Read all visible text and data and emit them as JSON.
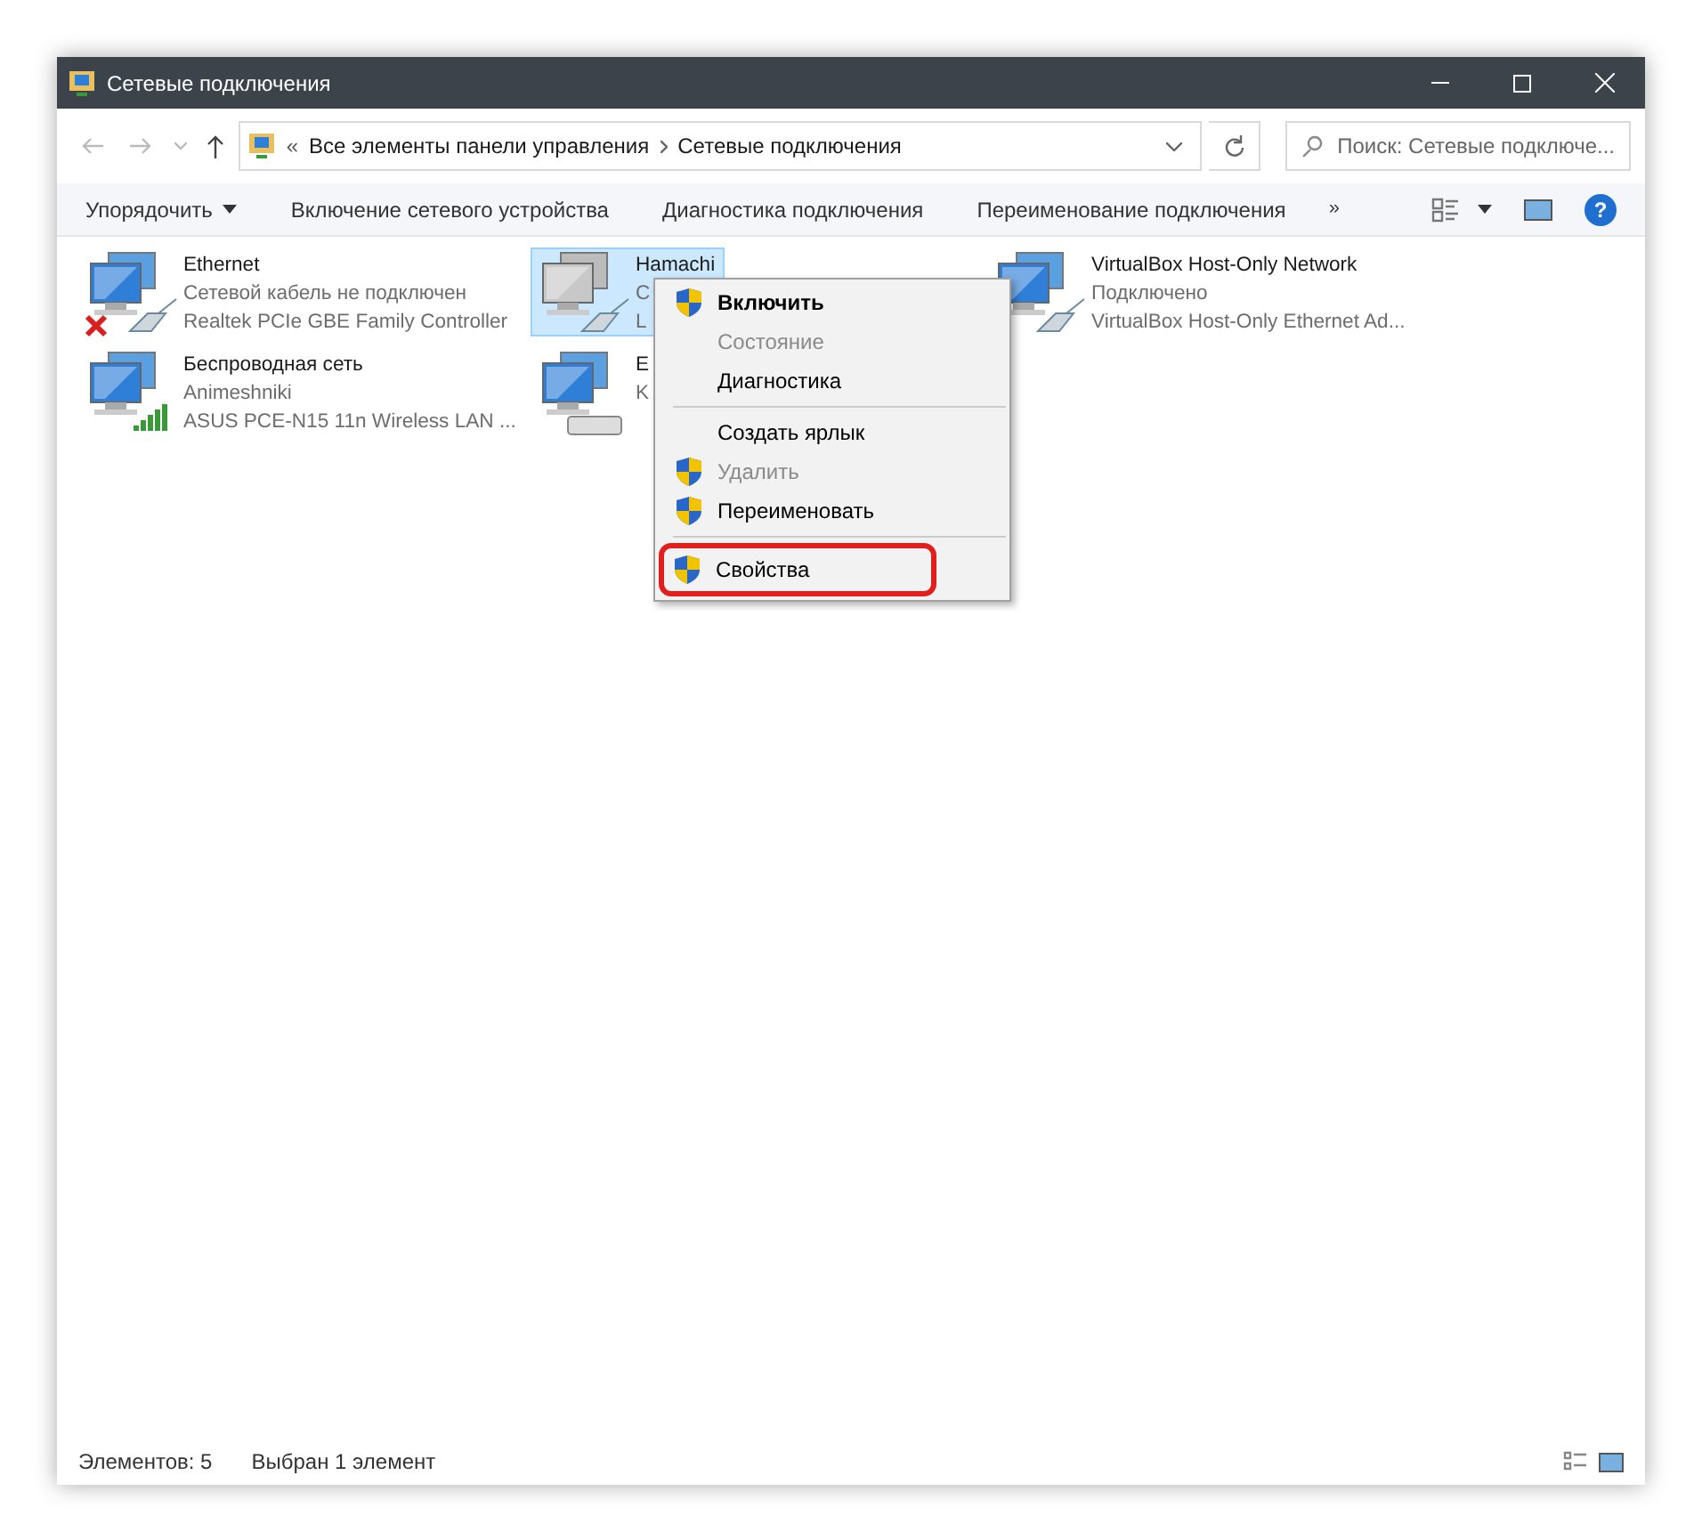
{
  "window": {
    "title": "Сетевые подключения"
  },
  "address": {
    "overflow": "«",
    "crumbs": [
      "Все элементы панели управления",
      "Сетевые подключения"
    ]
  },
  "search": {
    "placeholder": "Поиск: Сетевые подключе..."
  },
  "toolbar": {
    "items": [
      "Упорядочить",
      "Включение сетевого устройства",
      "Диагностика подключения",
      "Переименование подключения"
    ],
    "more": "»",
    "help": "?"
  },
  "connections": [
    {
      "name": "Ethernet",
      "status": "Сетевой кабель не подключен",
      "device": "Realtek PCIe GBE Family Controller",
      "kind": "cable",
      "disconnected": true,
      "selected": false
    },
    {
      "name": "Hamachi",
      "status": "С",
      "device": "L",
      "kind": "cable-grey",
      "disconnected": false,
      "selected": true
    },
    {
      "name": "VirtualBox Host-Only Network",
      "status": "Подключено",
      "device": "VirtualBox Host-Only Ethernet Ad...",
      "kind": "cable",
      "disconnected": false,
      "selected": false
    },
    {
      "name": "Беспроводная сеть",
      "status": "Animeshniki",
      "device": "ASUS PCE-N15 11n Wireless LAN ...",
      "kind": "wireless",
      "disconnected": false,
      "selected": false
    },
    {
      "name": "E",
      "status": "K",
      "kind": "dialup",
      "disconnected": false,
      "selected": false
    }
  ],
  "context_menu": [
    {
      "kind": "item",
      "label": "Включить",
      "bold": true,
      "disabled": false,
      "shield": true,
      "highlighted": false
    },
    {
      "kind": "item",
      "label": "Состояние",
      "bold": false,
      "disabled": true,
      "shield": false,
      "highlighted": false
    },
    {
      "kind": "item",
      "label": "Диагностика",
      "bold": false,
      "disabled": false,
      "shield": false,
      "highlighted": false
    },
    {
      "kind": "separator"
    },
    {
      "kind": "item",
      "label": "Создать ярлык",
      "bold": false,
      "disabled": false,
      "shield": false,
      "highlighted": false
    },
    {
      "kind": "item",
      "label": "Удалить",
      "bold": false,
      "disabled": true,
      "shield": true,
      "highlighted": false
    },
    {
      "kind": "item",
      "label": "Переименовать",
      "bold": false,
      "disabled": false,
      "shield": true,
      "highlighted": false
    },
    {
      "kind": "separator"
    },
    {
      "kind": "item",
      "label": "Свойства",
      "bold": false,
      "disabled": false,
      "shield": true,
      "highlighted": true
    }
  ],
  "status_bar": {
    "count": "Элементов: 5",
    "selection": "Выбран 1 элемент"
  }
}
